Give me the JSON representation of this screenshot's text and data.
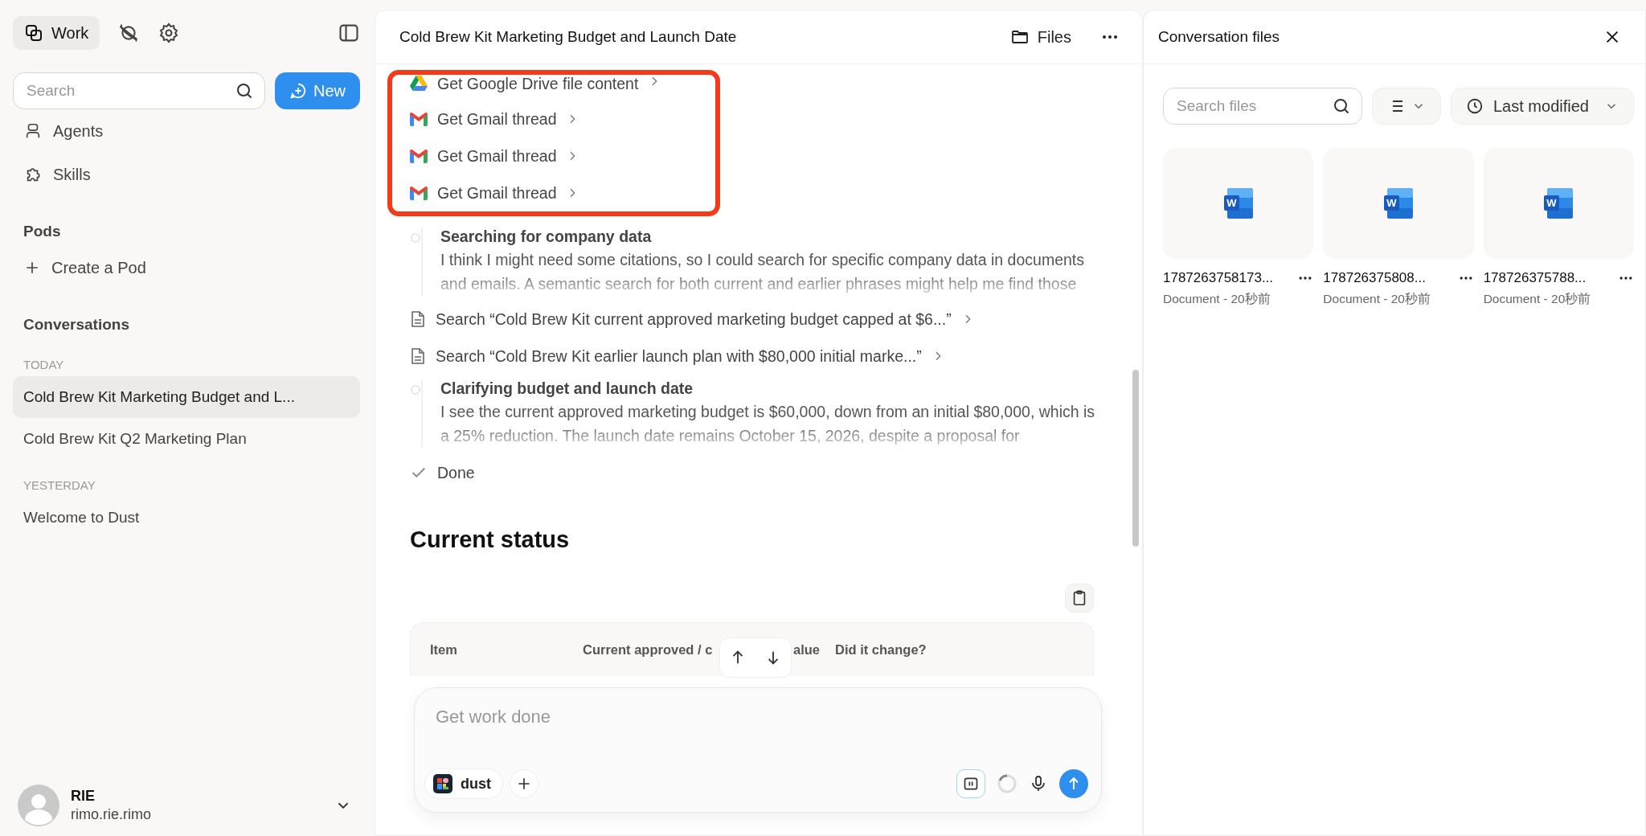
{
  "sidebar": {
    "tabs": [
      {
        "label": "Work",
        "selected": true
      }
    ],
    "search": {
      "placeholder": "Search"
    },
    "new_button": "New",
    "nav": [
      {
        "label": "Agents",
        "kind": "agents"
      },
      {
        "label": "Skills",
        "kind": "skills"
      }
    ],
    "pods": {
      "title": "Pods",
      "create": "Create a Pod"
    },
    "conversations": {
      "title": "Conversations",
      "groups": [
        {
          "label": "TODAY",
          "items": [
            {
              "title": "Cold Brew Kit Marketing Budget and L...",
              "selected": true
            },
            {
              "title": "Cold Brew Kit Q2 Marketing Plan",
              "selected": false
            }
          ]
        },
        {
          "label": "YESTERDAY",
          "items": [
            {
              "title": "Welcome to Dust",
              "selected": false
            }
          ]
        }
      ]
    },
    "user": {
      "name": "RIE",
      "handle": "rimo.rie.rimo"
    }
  },
  "conversation": {
    "title": "Cold Brew Kit Marketing Budget and Launch Date",
    "files_button": "Files",
    "steps": [
      {
        "kind": "drive",
        "label": "Get Google Drive file content",
        "highlighted": true
      },
      {
        "kind": "gmail",
        "label": "Get Gmail thread",
        "highlighted": true
      },
      {
        "kind": "gmail",
        "label": "Get Gmail thread",
        "highlighted": true
      },
      {
        "kind": "gmail",
        "label": "Get Gmail thread",
        "highlighted": true
      },
      {
        "kind": "thought",
        "title": "Searching for company data",
        "text": "I think I might need some citations, so I could search for specific company data in documents and emails. A semantic search for both current and earlier phrases might help me find those"
      },
      {
        "kind": "search",
        "label": "Search “Cold Brew Kit current approved marketing budget capped at $6...”",
        "highlighted": false
      },
      {
        "kind": "search",
        "label": "Search “Cold Brew Kit earlier launch plan with $80,000 initial marke...”",
        "highlighted": false
      },
      {
        "kind": "thought",
        "title": "Clarifying budget and launch date",
        "text": "I see the current approved marketing budget is $60,000, down from an initial $80,000, which is a 25% reduction. The launch date remains October 15, 2026, despite a proposal for"
      },
      {
        "kind": "done",
        "label": "Done"
      }
    ],
    "heading": "Current status",
    "table": {
      "columns": [
        "Item",
        "Current approved / c",
        "alue",
        "Did it change?"
      ]
    },
    "composer": {
      "placeholder": "Get work done",
      "agent": "dust"
    }
  },
  "files_panel": {
    "title": "Conversation files",
    "search": {
      "placeholder": "Search files"
    },
    "sort": "Last modified",
    "files": [
      {
        "name": "1787263758173...",
        "meta": "Document - 20秒前",
        "badge": "W"
      },
      {
        "name": "178726375808...",
        "meta": "Document - 20秒前",
        "badge": "W"
      },
      {
        "name": "178726375788...",
        "meta": "Document - 20秒前",
        "badge": "W"
      }
    ]
  }
}
